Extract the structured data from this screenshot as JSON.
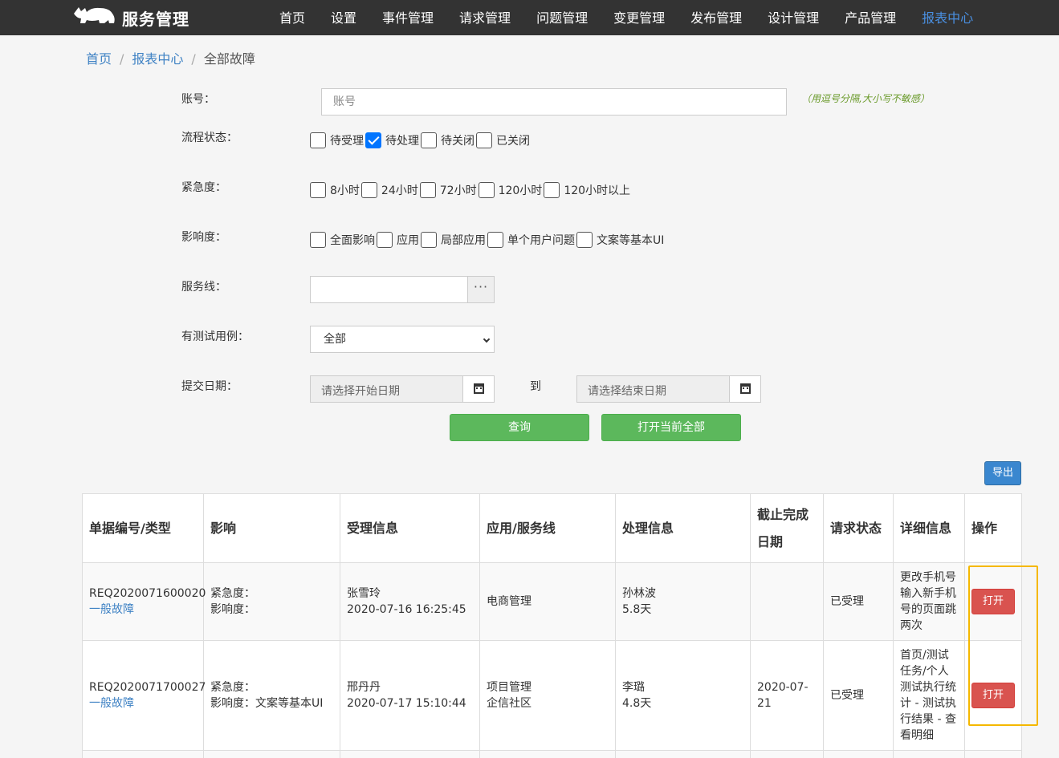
{
  "brand": {
    "title": "服务管理"
  },
  "nav": {
    "items": [
      "首页",
      "设置",
      "事件管理",
      "请求管理",
      "问题管理",
      "变更管理",
      "发布管理",
      "设计管理",
      "产品管理",
      "报表中心"
    ],
    "active": "报表中心"
  },
  "breadcrumb": [
    "首页",
    "报表中心",
    "全部故障"
  ],
  "form": {
    "account": {
      "label": "账号：",
      "placeholder": "账号",
      "hint": "（用逗号分隔,大小写不敏感）"
    },
    "flow_status": {
      "label": "流程状态：",
      "options": [
        {
          "label": "待受理",
          "checked": false
        },
        {
          "label": "待处理",
          "checked": true
        },
        {
          "label": "待关闭",
          "checked": false
        },
        {
          "label": "已关闭",
          "checked": false
        }
      ]
    },
    "urgency": {
      "label": "紧急度：",
      "options": [
        {
          "label": "8小时",
          "checked": false
        },
        {
          "label": "24小时",
          "checked": false
        },
        {
          "label": "72小时",
          "checked": false
        },
        {
          "label": "120小时",
          "checked": false
        },
        {
          "label": "120小时以上",
          "checked": false
        }
      ]
    },
    "impact": {
      "label": "影响度：",
      "options": [
        {
          "label": "全面影响",
          "checked": false
        },
        {
          "label": "应用",
          "checked": false
        },
        {
          "label": "局部应用",
          "checked": false
        },
        {
          "label": "单个用户问题",
          "checked": false
        },
        {
          "label": "文案等基本UI",
          "checked": false
        }
      ]
    },
    "service_line": {
      "label": "服务线：",
      "value": "",
      "picker_label": "···"
    },
    "has_test_case": {
      "label": "有测试用例：",
      "selected": "全部"
    },
    "submit_date": {
      "label": "提交日期：",
      "start_placeholder": "请选择开始日期",
      "to_label": "到",
      "end_placeholder": "请选择结束日期"
    },
    "query_button": "查询",
    "open_all_button": "打开当前全部"
  },
  "export_button": "导出",
  "table": {
    "headers": [
      "单据编号/类型",
      "影响",
      "受理信息",
      "应用/服务线",
      "处理信息",
      "截止完成日期",
      "请求状态",
      "详细信息",
      "操作"
    ],
    "rows": [
      {
        "id": "REQ2020071600020",
        "type": "一般故障",
        "urgency": "紧急度：",
        "impact": "影响度：",
        "accept_name": "张雪玲",
        "accept_time": "2020-07-16 16:25:45",
        "app": "电商管理",
        "service_line": "",
        "handler": "孙林波",
        "duration": "5.8天",
        "deadline": "",
        "status": "已受理",
        "detail": "更改手机号输入新手机号的页面跳两次",
        "action": "打开"
      },
      {
        "id": "REQ2020071700027",
        "type": "一般故障",
        "urgency": "紧急度：",
        "impact": "影响度：文案等基本UI",
        "accept_name": "邢丹丹",
        "accept_time": "2020-07-17 15:10:44",
        "app": "项目管理",
        "service_line": "企信社区",
        "handler": "李璐",
        "duration": "4.8天",
        "deadline": "2020-07-21",
        "status": "已受理",
        "detail": "首页/测试任务/个人测试执行统计 - 测试执行结果 - 查看明细",
        "action": "打开"
      }
    ]
  }
}
